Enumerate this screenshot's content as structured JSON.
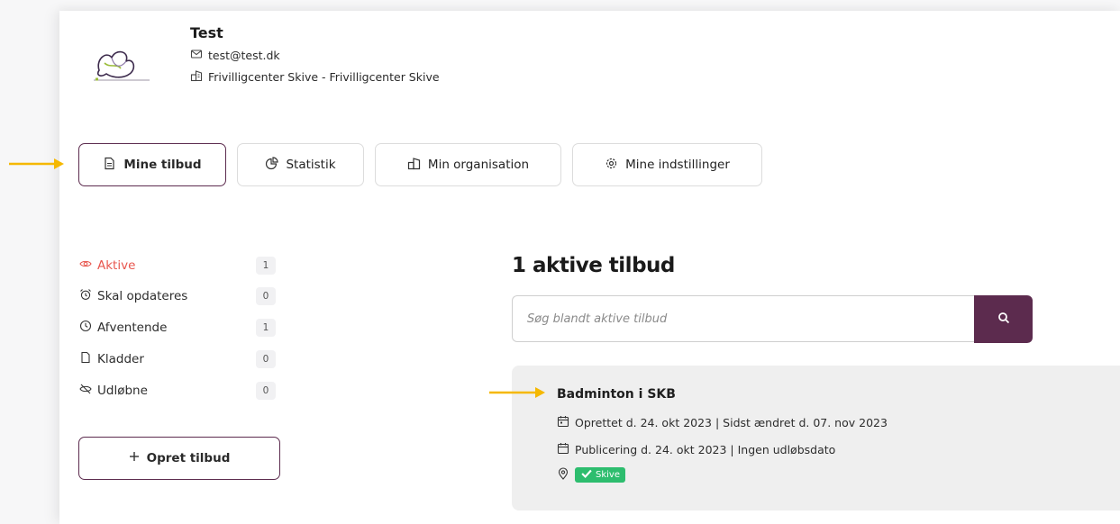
{
  "profile": {
    "name": "Test",
    "email": "test@test.dk",
    "organization": "Frivilligcenter Skive - Frivilligcenter Skive",
    "logo_icon": "frivilligcenter-logo"
  },
  "tabs": [
    {
      "label": "Mine tilbud",
      "icon": "document-icon",
      "active": true
    },
    {
      "label": "Statistik",
      "icon": "pie-chart-icon",
      "active": false
    },
    {
      "label": "Min organisation",
      "icon": "building-icon",
      "active": false
    },
    {
      "label": "Mine indstillinger",
      "icon": "gear-icon",
      "active": false
    }
  ],
  "sidebar": {
    "items": [
      {
        "label": "Aktive",
        "count": "1",
        "icon": "eye-icon",
        "active": true
      },
      {
        "label": "Skal opdateres",
        "count": "0",
        "icon": "alarm-clock-icon",
        "active": false
      },
      {
        "label": "Afventende",
        "count": "1",
        "icon": "clock-icon",
        "active": false
      },
      {
        "label": "Kladder",
        "count": "0",
        "icon": "file-icon",
        "active": false
      },
      {
        "label": "Udløbne",
        "count": "0",
        "icon": "eye-off-icon",
        "active": false
      }
    ],
    "create_label": "Opret tilbud"
  },
  "main": {
    "heading": "1 aktive tilbud",
    "search_placeholder": "Søg blandt aktive tilbud",
    "offer": {
      "title": "Badminton i SKB",
      "created_line": "Oprettet d. 24. okt 2023 | Sidst ændret d. 07. nov 2023",
      "publish_line": "Publicering d. 24. okt 2023 | Ingen udløbsdato",
      "location_tag": "Skive"
    }
  },
  "colors": {
    "brand": "#5c2b4e",
    "active_red": "#e8574f",
    "tag_green": "#2dbd6e",
    "arrow": "#f5b800"
  }
}
